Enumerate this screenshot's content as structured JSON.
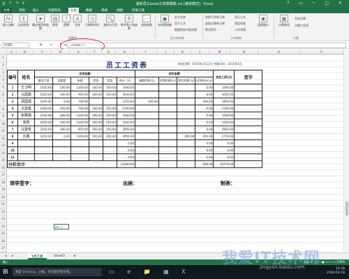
{
  "titlebar": {
    "qat": "🖫 ↶ ↷ ▾",
    "title": "最新员工excel工资表模板.xls [兼容模式] - Excel",
    "controls": "? ▭ ─ ▢ ✕"
  },
  "tabs": [
    "文件",
    "开始",
    "插入",
    "页面布局",
    "公式",
    "数据",
    "审阅",
    "视图",
    "开发工具"
  ],
  "ribbon": {
    "buttons": [
      {
        "icon": "fx",
        "label": "插入函数"
      },
      {
        "icon": "Σ",
        "label": "自动求和"
      },
      {
        "icon": "★",
        "label": "最近使用的函数"
      },
      {
        "icon": "▤",
        "label": "财务"
      },
      {
        "icon": "?",
        "label": "逻辑"
      },
      {
        "icon": "A",
        "label": "文本"
      },
      {
        "icon": "◷",
        "label": "日期和时间"
      },
      {
        "icon": "🔍",
        "label": "查找与引用"
      },
      {
        "icon": "θ",
        "label": "数学和三角函数"
      },
      {
        "icon": "⋯",
        "label": "其他函数"
      },
      {
        "icon": "▣",
        "label": "名称管理器"
      }
    ],
    "names_group": [
      "定义名称",
      "用于公式",
      "根据所选内容创建"
    ],
    "audit_group": [
      "追踪引用单元格",
      "追踪从属单元格",
      "移去箭头",
      "显示公式",
      "错误检查",
      "公式求值"
    ],
    "watch": "监视窗口",
    "calc_options": "计算选项",
    "calc_small": [
      "开始计算",
      "计算工作表"
    ],
    "group_labels": {
      "library": "函数库",
      "names": "定义的名称",
      "audit": "公式审核",
      "calc": "计算"
    }
  },
  "formulabar": {
    "namebox": "CODE",
    "icons": "✕ ✓ fx",
    "formula": "=code ( )"
  },
  "columns": [
    "A",
    "B",
    "C",
    "D",
    "E",
    "F",
    "G",
    "H",
    "I",
    "J",
    "K",
    "L",
    "M",
    "N",
    "O",
    "P"
  ],
  "rows": [
    "1",
    "2",
    "3",
    "4",
    "5",
    "6",
    "7",
    "8",
    "9",
    "10",
    "11",
    "12",
    "13",
    "14",
    "15",
    "16",
    "17",
    "18",
    "19",
    "20",
    "21",
    "22",
    "23",
    "24",
    "25",
    "26",
    "27"
  ],
  "sheet": {
    "title": "员工工资表",
    "date_strip": "发放日期：2015年1月12日  所属月份：2015年1月",
    "header": {
      "num": "编号",
      "name": "姓名",
      "should_pay": "应发金额",
      "deduct": "应扣金额",
      "net": "实发工资(元)",
      "sign": "签字",
      "sub": [
        "基本工资",
        "全勤奖",
        "补助",
        "奖金",
        "奖金",
        "合计（元）",
        "请假扣款(元)",
        "迟到扣款(元)",
        "其它扣款(元)",
        "应扣合计(元)"
      ]
    },
    "employees": [
      {
        "no": "1",
        "name": "王卫明",
        "v": [
          "1450.00",
          "200.00",
          "1200.00",
          "100.00",
          "350.00",
          "3300.00",
          "",
          "",
          "",
          "0.00",
          "3300.00"
        ]
      },
      {
        "no": "2",
        "name": "马国鑫",
        "v": [
          "1450.00",
          "200.00",
          "950.00",
          "100.00",
          "350.00",
          "3050.00",
          "",
          "",
          "",
          "0.00",
          "3050.00"
        ]
      },
      {
        "no": "3",
        "name": "郑国斌",
        "v": [
          "1450.00",
          "0.00",
          "700.00",
          "",
          "",
          "2150.00",
          "300.00",
          "",
          "",
          "300.00",
          "1850.00"
        ]
      },
      {
        "no": "4",
        "name": "马登桑",
        "v": [
          "1450.00",
          "200.00",
          "700.00",
          "100.00",
          "250.00",
          "2700.00",
          "",
          "",
          "",
          "0.00",
          "2700.00"
        ]
      },
      {
        "no": "5",
        "name": "张要蕾",
        "v": [
          "1450.00",
          "200.00",
          "1100.00",
          "100.00",
          "250.00",
          "3100.00",
          "",
          "",
          "",
          "0.00",
          "3100.00"
        ]
      },
      {
        "no": "6",
        "name": "高阳",
        "v": [
          "1450.00",
          "200.00",
          "1100.00",
          "100.00",
          "250.00",
          "3100.00",
          "",
          "",
          "",
          "0.00",
          "3100.00"
        ]
      },
      {
        "no": "7",
        "name": "马登俊",
        "v": [
          "1450.00",
          "200.00",
          "950.00",
          "100.00",
          "250.00",
          "2950.00",
          "",
          "",
          "",
          "0.00",
          "2950.00"
        ]
      },
      {
        "no": "8",
        "name": "刘鑫",
        "v": [
          "1450.00",
          "0.00",
          "1200.00",
          "100.00",
          "200.00",
          "2950.00",
          "",
          "",
          "200.00",
          "200.00",
          "2750.00"
        ]
      },
      {
        "no": "9",
        "name": "",
        "v": [
          "",
          "",
          "",
          "",
          "",
          "0.00",
          "",
          "",
          "",
          "0.00",
          "0.00"
        ]
      },
      {
        "no": "10",
        "name": "",
        "v": [
          "",
          "",
          "",
          "",
          "",
          "0.00",
          "",
          "",
          "",
          "0.00",
          "0.00"
        ]
      },
      {
        "no": "11",
        "name": "",
        "v": [
          "",
          "",
          "",
          "",
          "",
          "0.00",
          "",
          "",
          "",
          "0.00",
          "0.00"
        ]
      }
    ],
    "total": {
      "label": "分栏合计",
      "should": "23300.00",
      "deduct": "500.00",
      "net": "16770.00"
    },
    "signature": {
      "leader": "领导签字：",
      "cashier": "出纳：",
      "maker": "制表："
    },
    "cell_note": "de ( )"
  },
  "sheettabs": [
    "◂",
    "▸",
    "5月工资",
    "Sheet3",
    "⊕"
  ],
  "statusbar": {
    "left": "输入",
    "right": "⊞  ▤  ⊟  ─────●───── +  100%"
  },
  "taskbar": {
    "start": "⊞",
    "search": "我是 Cortana，小娜。有问题尽管问我。",
    "apps": "▭ e 📁 ▦ X",
    "time": "14:38",
    "date": "2016-02-18"
  },
  "watermark": {
    "main": "我爱IT技术网",
    "sub": "jingyan.baidu.com"
  },
  "accent_color": "#217346",
  "annotation_color": "#e02020"
}
